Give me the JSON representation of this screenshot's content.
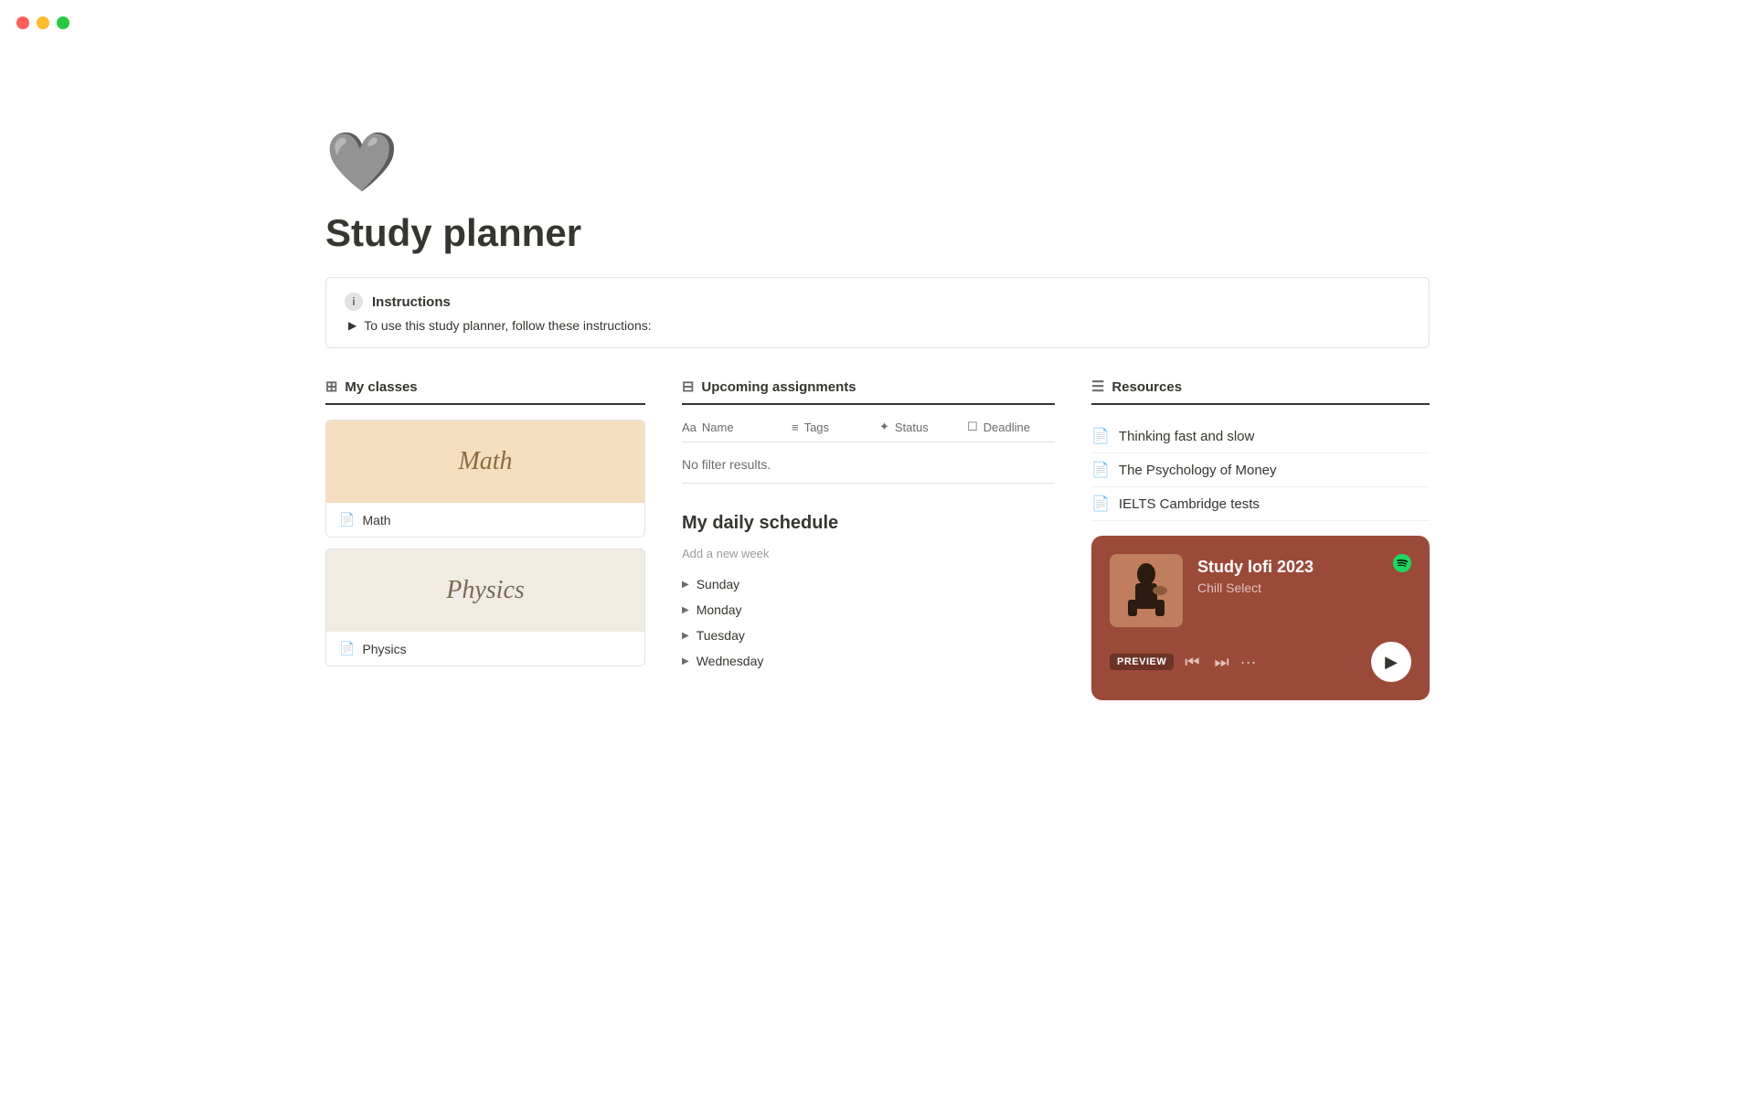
{
  "window": {
    "traffic_lights": {
      "red": "close",
      "yellow": "minimize",
      "green": "maximize"
    }
  },
  "page": {
    "icon": "🩶",
    "title": "Study planner"
  },
  "instructions": {
    "label": "Instructions",
    "body": "To use this study planner, follow these instructions:"
  },
  "my_classes": {
    "header": "My classes",
    "items": [
      {
        "name": "Math",
        "banner_label": "Math",
        "style": "math"
      },
      {
        "name": "Physics",
        "banner_label": "Physics",
        "style": "physics"
      }
    ]
  },
  "upcoming_assignments": {
    "header": "Upcoming assignments",
    "columns": [
      {
        "label": "Name",
        "icon": "Aa"
      },
      {
        "label": "Tags",
        "icon": "≡"
      },
      {
        "label": "Status",
        "icon": "✦"
      },
      {
        "label": "Deadline",
        "icon": "☐"
      }
    ],
    "empty_text": "No filter results."
  },
  "daily_schedule": {
    "title": "My daily schedule",
    "add_week_placeholder": "Add a new week",
    "days": [
      "Sunday",
      "Monday",
      "Tuesday",
      "Wednesday"
    ]
  },
  "resources": {
    "header": "Resources",
    "items": [
      {
        "label": "Thinking fast and slow"
      },
      {
        "label": "The Psychology of Money"
      },
      {
        "label": "IELTS Cambridge tests"
      }
    ]
  },
  "spotify": {
    "preview_label": "PREVIEW",
    "track": "Study lofi 2023",
    "artist": "Chill Select",
    "logo_symbol": "●"
  }
}
